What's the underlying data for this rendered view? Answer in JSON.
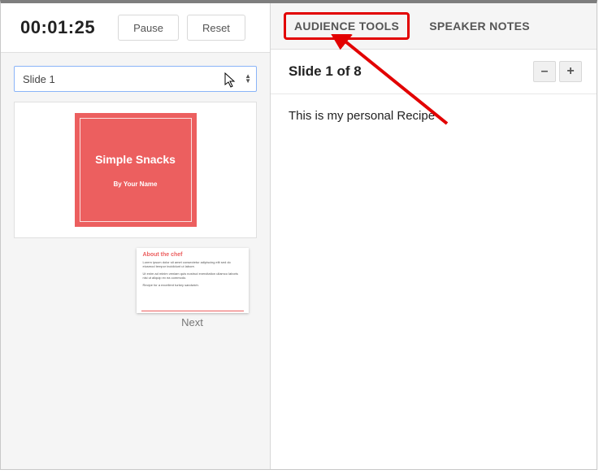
{
  "timer": "00:01:25",
  "buttons": {
    "pause": "Pause",
    "reset": "Reset"
  },
  "slideSelect": {
    "label": "Slide 1"
  },
  "slidePreview": {
    "title": "Simple Snacks",
    "subtitle": "By Your Name"
  },
  "nextThumb": {
    "heading": "About the chef",
    "body1": "Lorem ipsum dolor sit amet consectetur adipiscing elit sed do eiusmod tempor incididunt ut labore.",
    "body2": "Ut enim ad minim veniam quis nostrud exercitation ullamco laboris nisi ut aliquip ex ea commodo.",
    "body3": "Recipe for a excellent turkey sandwich.",
    "label": "Next"
  },
  "tabs": {
    "audience": "AUDIENCE TOOLS",
    "speaker": "SPEAKER NOTES"
  },
  "notes": {
    "header": "Slide 1 of 8",
    "zoomMinus": "–",
    "zoomPlus": "+",
    "body": "This is my personal Recipe"
  }
}
